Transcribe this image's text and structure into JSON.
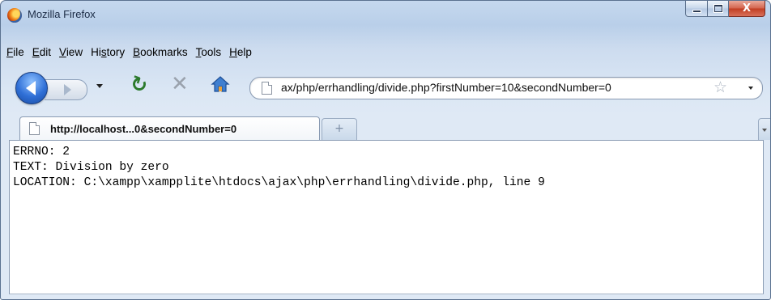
{
  "window": {
    "title": "Mozilla Firefox"
  },
  "caption_buttons": {
    "minimize": "minimize-icon",
    "maximize": "maximize-icon",
    "close": "X"
  },
  "menu": [
    {
      "pre": "",
      "key": "F",
      "post": "ile"
    },
    {
      "pre": "",
      "key": "E",
      "post": "dit"
    },
    {
      "pre": "",
      "key": "V",
      "post": "iew"
    },
    {
      "pre": "Hi",
      "key": "s",
      "post": "tory"
    },
    {
      "pre": "",
      "key": "B",
      "post": "ookmarks"
    },
    {
      "pre": "",
      "key": "T",
      "post": "ools"
    },
    {
      "pre": "",
      "key": "H",
      "post": "elp"
    }
  ],
  "navigation": {
    "icons": [
      "back-arrow-icon",
      "forward-arrow-icon",
      "reload-icon",
      "stop-icon",
      "home-icon",
      "star-icon"
    ],
    "url": "ax/php/errhandling/divide.php?firstNumber=10&secondNumber=0"
  },
  "tabs": [
    {
      "label": "http://localhost...0&secondNumber=0"
    }
  ],
  "newtab_glyph": "+",
  "content": {
    "lines": [
      "ERRNO: 2",
      "TEXT: Division by zero",
      "LOCATION: C:\\xampp\\xampplite\\htdocs\\ajax\\php\\errhandling\\divide.php, line 9"
    ]
  },
  "colors": {
    "chrome": "#c5d8ee",
    "close_button": "#c13e22",
    "reload": "#2c7a2c"
  }
}
